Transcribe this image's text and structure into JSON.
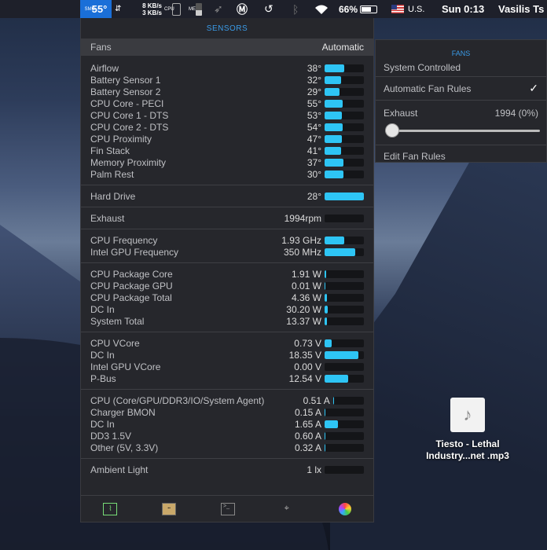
{
  "menubar": {
    "temp_label_vertical": "SMC",
    "temp_value": "55°",
    "net_up": "8 KB/s",
    "net_down": "3 KB/s",
    "cpu_vertical": "CPU",
    "mem_vertical": "MEM",
    "battery_percent": "66%",
    "input_source": "U.S.",
    "clock": "Sun 0:13",
    "user": "Vasilis Ts"
  },
  "sensors": {
    "title": "SENSORS",
    "fans_label": "Fans",
    "fans_value": "Automatic",
    "groups": [
      [
        {
          "name": "Airflow",
          "value": "38°",
          "fill": 0.5
        },
        {
          "name": "Battery Sensor 1",
          "value": "32°",
          "fill": 0.42
        },
        {
          "name": "Battery Sensor 2",
          "value": "29°",
          "fill": 0.38
        },
        {
          "name": "CPU Core - PECI",
          "value": "55°",
          "fill": 0.46
        },
        {
          "name": "CPU Core 1 - DTS",
          "value": "53°",
          "fill": 0.44
        },
        {
          "name": "CPU Core 2 - DTS",
          "value": "54°",
          "fill": 0.45
        },
        {
          "name": "CPU Proximity",
          "value": "47°",
          "fill": 0.44
        },
        {
          "name": "Fin Stack",
          "value": "41°",
          "fill": 0.42
        },
        {
          "name": "Memory Proximity",
          "value": "37°",
          "fill": 0.48
        },
        {
          "name": "Palm Rest",
          "value": "30°",
          "fill": 0.48
        }
      ],
      [
        {
          "name": "Hard Drive",
          "value": "28°",
          "fill": 1.0
        }
      ],
      [
        {
          "name": "Exhaust",
          "value": "1994rpm",
          "fill": 0.0
        }
      ],
      [
        {
          "name": "CPU Frequency",
          "value": "1.93 GHz",
          "fill": 0.5
        },
        {
          "name": "Intel GPU Frequency",
          "value": "350 MHz",
          "fill": 0.78
        }
      ],
      [
        {
          "name": "CPU Package Core",
          "value": "1.91 W",
          "fill": 0.04
        },
        {
          "name": "CPU Package GPU",
          "value": "0.01 W",
          "fill": 0.02
        },
        {
          "name": "CPU Package Total",
          "value": "4.36 W",
          "fill": 0.06
        },
        {
          "name": "DC In",
          "value": "30.20 W",
          "fill": 0.08
        },
        {
          "name": "System Total",
          "value": "13.37 W",
          "fill": 0.06
        }
      ],
      [
        {
          "name": "CPU VCore",
          "value": "0.73 V",
          "fill": 0.18
        },
        {
          "name": "DC In",
          "value": "18.35 V",
          "fill": 0.86
        },
        {
          "name": "Intel GPU VCore",
          "value": "0.00 V",
          "fill": 0.0
        },
        {
          "name": "P-Bus",
          "value": "12.54 V",
          "fill": 0.6
        }
      ],
      [
        {
          "name": "CPU (Core/GPU/DDR3/IO/System Agent)",
          "value": "0.51 A",
          "fill": 0.02
        },
        {
          "name": "Charger BMON",
          "value": "0.15 A",
          "fill": 0.02
        },
        {
          "name": "DC In",
          "value": "1.65 A",
          "fill": 0.34
        },
        {
          "name": "DD3 1.5V",
          "value": "0.60 A",
          "fill": 0.02
        },
        {
          "name": "Other (5V, 3.3V)",
          "value": "0.32 A",
          "fill": 0.02
        }
      ],
      [
        {
          "name": "Ambient Light",
          "value": "1 lx",
          "fill": 0.0
        }
      ]
    ]
  },
  "fans_menu": {
    "title": "FANS",
    "system_controlled": "System Controlled",
    "automatic_rules": "Automatic Fan Rules",
    "checkmark": "✓",
    "exhaust_label": "Exhaust",
    "exhaust_value": "1994 (0%)",
    "exhaust_slider_fraction": 0.0,
    "edit_rules": "Edit Fan Rules"
  },
  "desktop_file": {
    "name_line1": "Tiesto - Lethal",
    "name_line2": "Industry...net .mp3"
  },
  "colors": {
    "accent_blue": "#3a9be8",
    "bar_fill": "#2ec5f5",
    "panel_bg": "#26272c"
  },
  "icons": [
    "activity-monitor-icon",
    "console-warning-icon",
    "terminal-icon",
    "network-utility-icon",
    "color-sync-icon"
  ]
}
